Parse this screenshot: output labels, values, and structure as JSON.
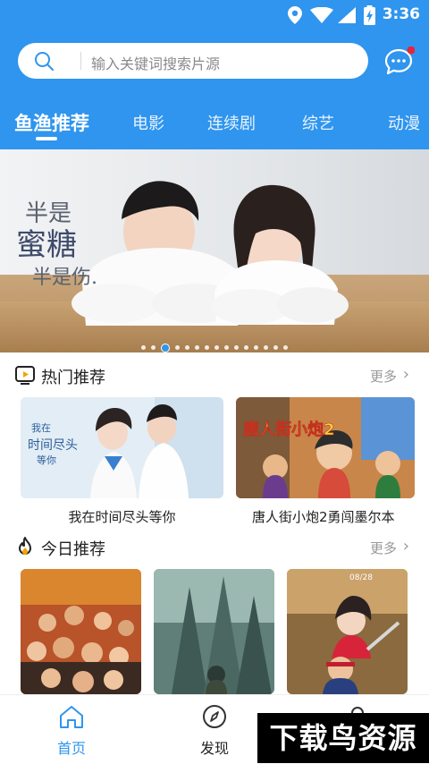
{
  "status_bar": {
    "time": "3:36"
  },
  "search": {
    "placeholder": "输入关键词搜索片源"
  },
  "tabs": [
    {
      "label": "鱼渔推荐",
      "active": true
    },
    {
      "label": "电影"
    },
    {
      "label": "连续剧"
    },
    {
      "label": "综艺"
    },
    {
      "label": "动漫"
    }
  ],
  "banner": {
    "overlay_text": "半是蜜糖 半是伤",
    "slide_count": 15,
    "active_slide": 3
  },
  "hot": {
    "title": "热门推荐",
    "more": "更多",
    "items": [
      {
        "title": "我在时间尽头等你",
        "poster_text": "我在时间尽头等你"
      },
      {
        "title": "唐人街小炮2勇闯墨尔本",
        "poster_text": "唐人街小炮2"
      }
    ]
  },
  "today": {
    "title": "今日推荐",
    "more": "更多",
    "items": [
      {
        "poster": "poster-crowd"
      },
      {
        "poster": "poster-city"
      },
      {
        "poster": "poster-action",
        "poster_text": "08/28"
      }
    ]
  },
  "tabbar": {
    "items": [
      {
        "label": "首页",
        "icon": "home-icon",
        "active": true
      },
      {
        "label": "发现",
        "icon": "compass-icon"
      },
      {
        "label": "",
        "icon": "user-icon"
      }
    ]
  },
  "watermark": "下载鸟资源",
  "colors": {
    "accent": "#2f95ee",
    "badge": "#e8243c"
  }
}
